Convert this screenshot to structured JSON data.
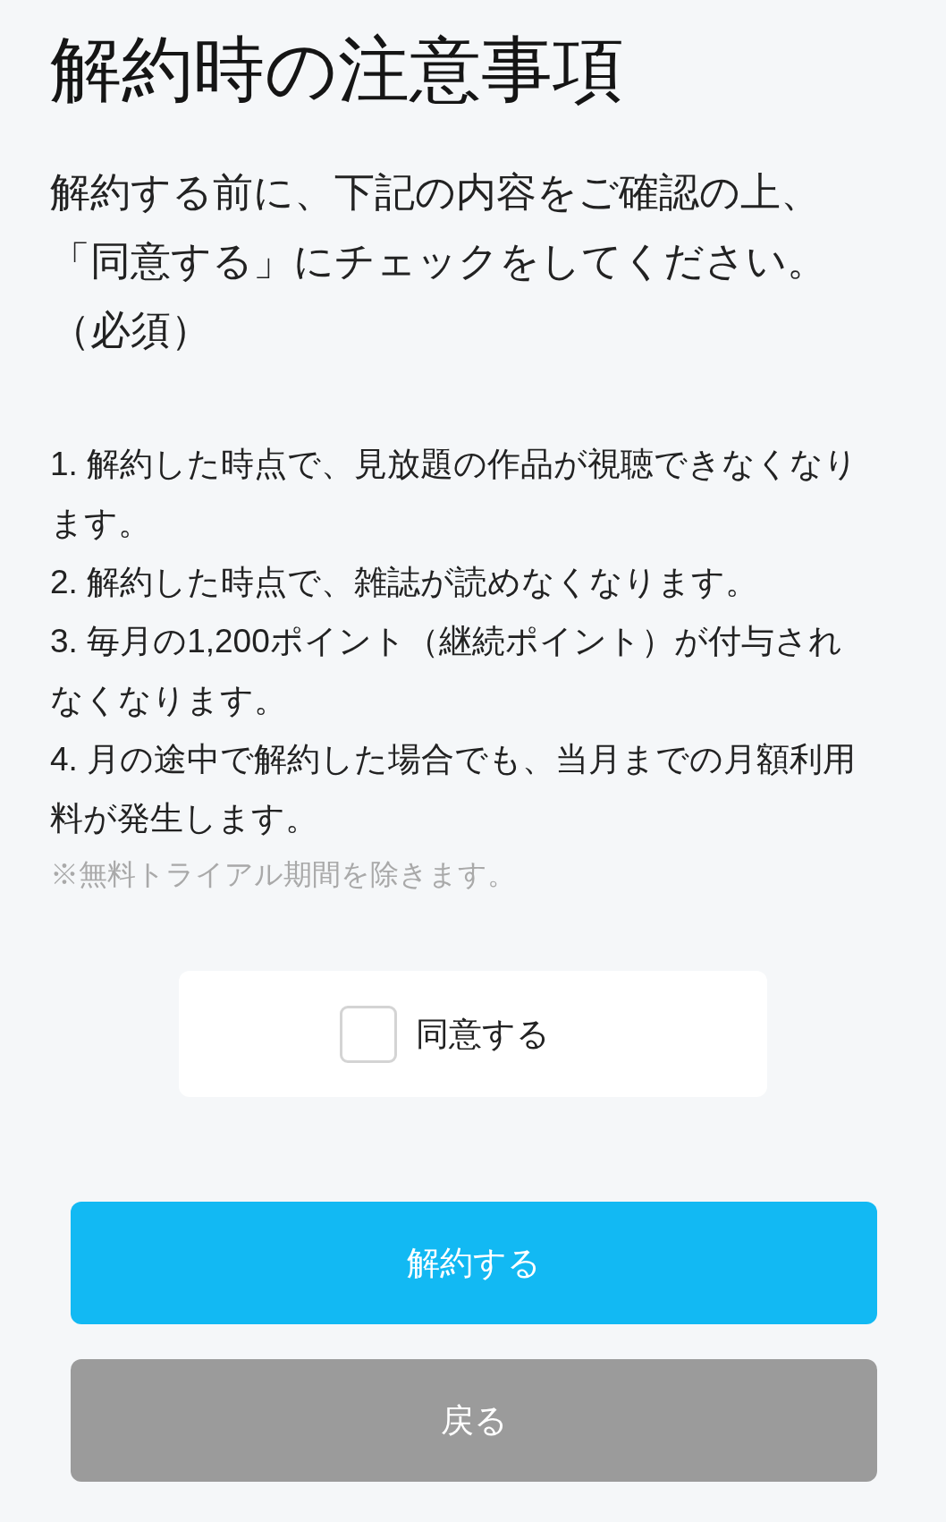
{
  "page": {
    "title": "解約時の注意事項"
  },
  "intro": {
    "lines": [
      "解約する前に、下記の内容をご確認の上、",
      "「同意する」にチェックをしてください。",
      "（必須）"
    ]
  },
  "notices": [
    {
      "lines": [
        "1. 解約した時点で、見放題の作品が視聴できなくなり",
        "ます。"
      ]
    },
    {
      "lines": [
        "2. 解約した時点で、雑誌が読めなくなります。"
      ]
    },
    {
      "lines": [
        "3. 毎月の1,200ポイント（継続ポイント）が付与され",
        "なくなります。"
      ]
    },
    {
      "lines": [
        "4. 月の途中で解約した場合でも、当月までの月額利用",
        "料が発生します。"
      ]
    }
  ],
  "note": "※無料トライアル期間を除きます。",
  "agreement": {
    "label": "同意する",
    "checked": false
  },
  "buttons": [
    {
      "label": "解約する",
      "kind": "primary"
    },
    {
      "label": "戻る",
      "kind": "secondary"
    }
  ]
}
